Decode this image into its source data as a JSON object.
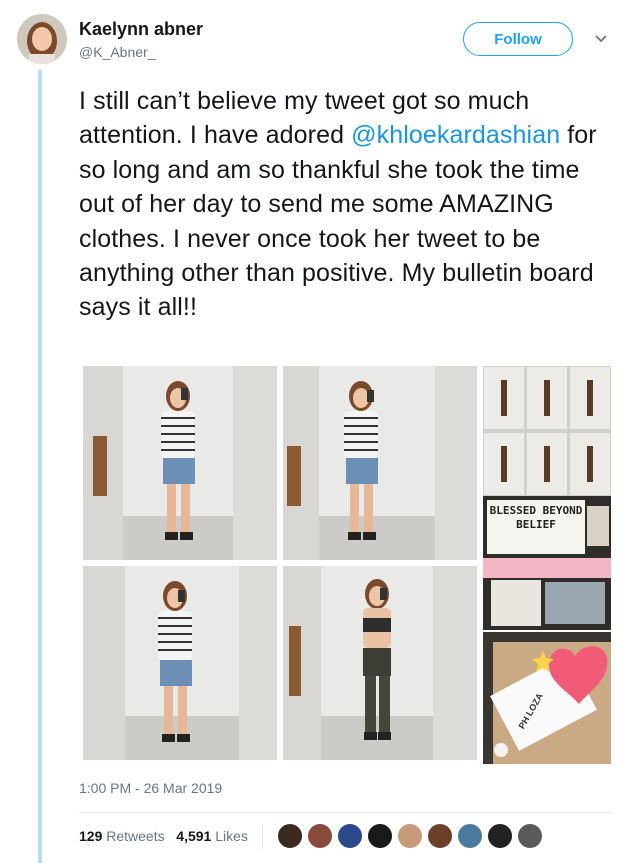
{
  "user": {
    "name": "Kaelynn abner",
    "handle": "@K_Abner_"
  },
  "follow_label": "Follow",
  "tweet": {
    "before": "I still can’t believe my tweet got so much attention. I have adored ",
    "mention": "@khloekardashian",
    "after": " for so long and am so thankful she took the time out of her day to send me some AMAZING clothes. I never once took her tweet to be anything other than positive. My bulletin board says it all!!"
  },
  "board_sign": "BLESSED BEYOND BELIEF",
  "package_label": "PH LOZA",
  "timestamp": "1:00 PM - 26 Mar 2019",
  "stats": {
    "retweets_count": "129",
    "retweets_label": "Retweets",
    "likes_count": "4,591",
    "likes_label": "Likes"
  },
  "colors": {
    "accent": "#1da1f2",
    "mention": "#1b95e0",
    "muted": "#657786"
  }
}
